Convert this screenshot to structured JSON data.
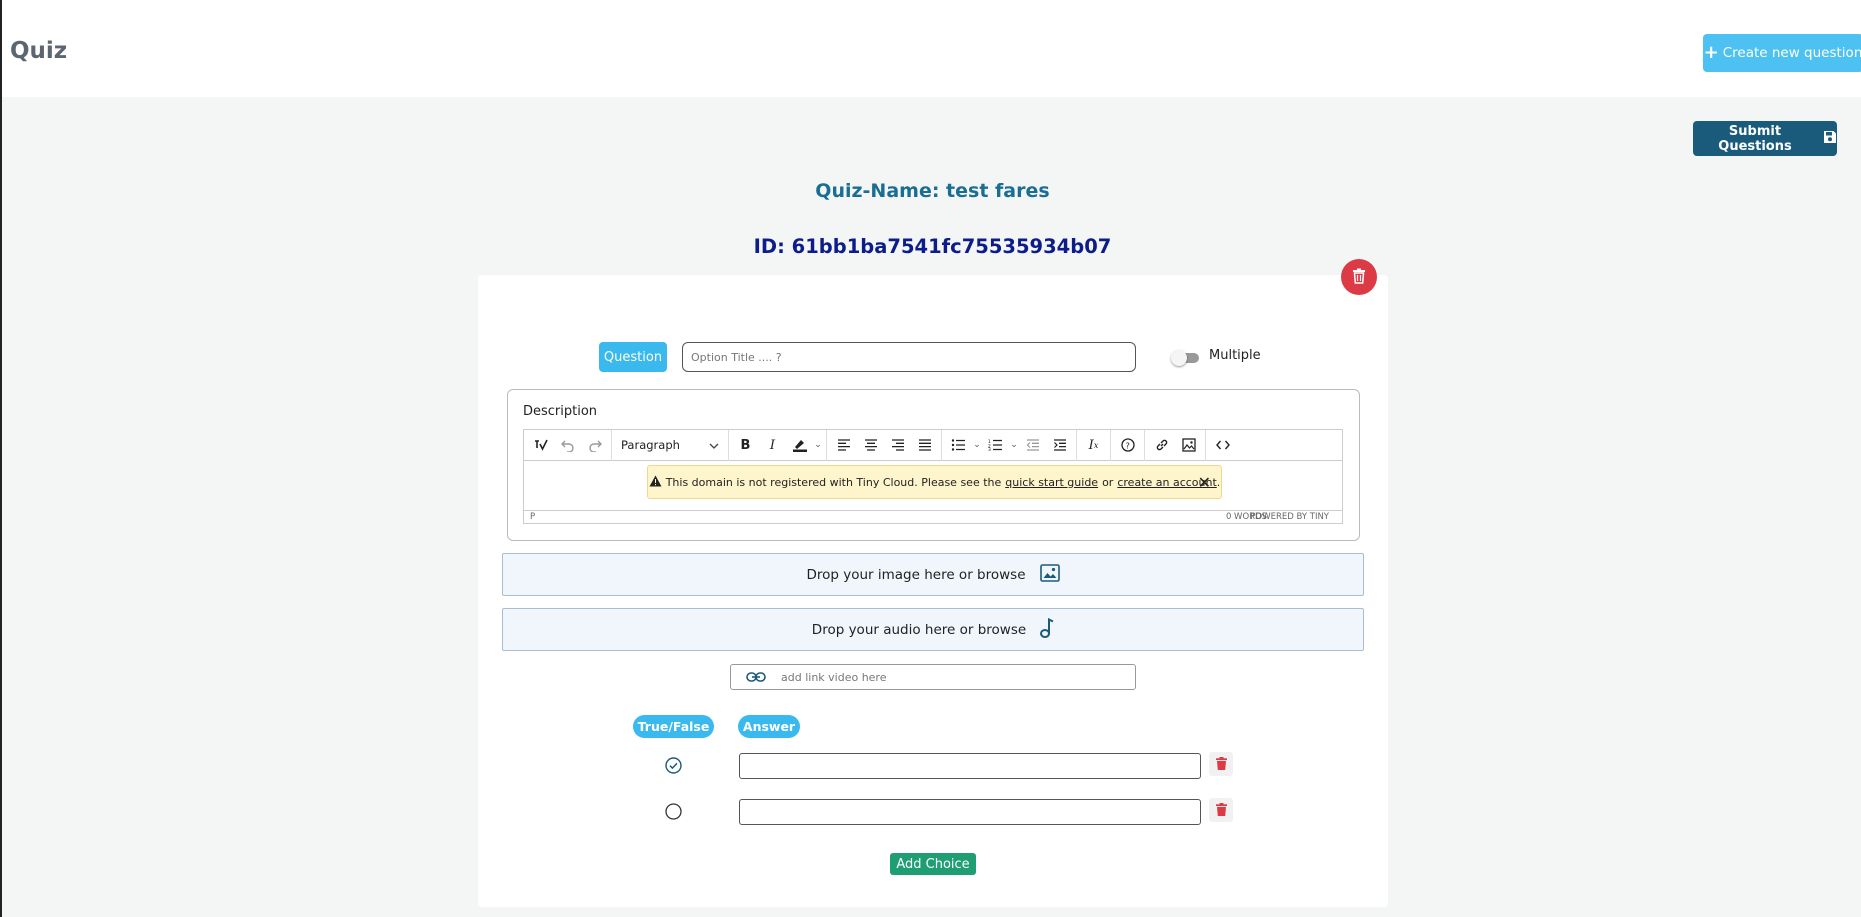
{
  "header": {
    "title": "Quiz",
    "create_button": "Create new question"
  },
  "submit_button": "Submit Questions",
  "quiz": {
    "name_line": "Quiz-Name: test fares",
    "id_line": "ID: 61bb1ba7541fc75535934b07"
  },
  "question": {
    "label": "Question",
    "title_placeholder": "Option Title .... ?",
    "multiple_label": "Multiple",
    "multiple_enabled": false
  },
  "description": {
    "label": "Description",
    "block_format": "Paragraph",
    "notice": {
      "text_before": "This domain is not registered with Tiny Cloud. Please see the",
      "link1": "quick start guide",
      "middle": "or",
      "link2": "create an account",
      "end": "."
    },
    "status_path": "P",
    "word_count": "0 WORDS",
    "powered_by": "POWERED BY TINY"
  },
  "drop_image": {
    "text": "Drop your image here or browse",
    "icon": "image-icon"
  },
  "drop_audio": {
    "text": "Drop your audio here or browse",
    "icon": "music-note-icon"
  },
  "video": {
    "placeholder": "add link video here",
    "icon": "link-icon"
  },
  "choices": {
    "col_true_false": "True/False",
    "col_answer": "Answer",
    "rows": [
      {
        "correct": true,
        "value": ""
      },
      {
        "correct": false,
        "value": ""
      }
    ],
    "add_button": "Add Choice"
  },
  "colors": {
    "primary_light": "#3ab9ef",
    "primary_dark": "#1a5b7c",
    "danger": "#dc3b46",
    "success": "#1f9e73",
    "quiz_name": "#1a6d93",
    "quiz_id": "#0c1d8a"
  }
}
